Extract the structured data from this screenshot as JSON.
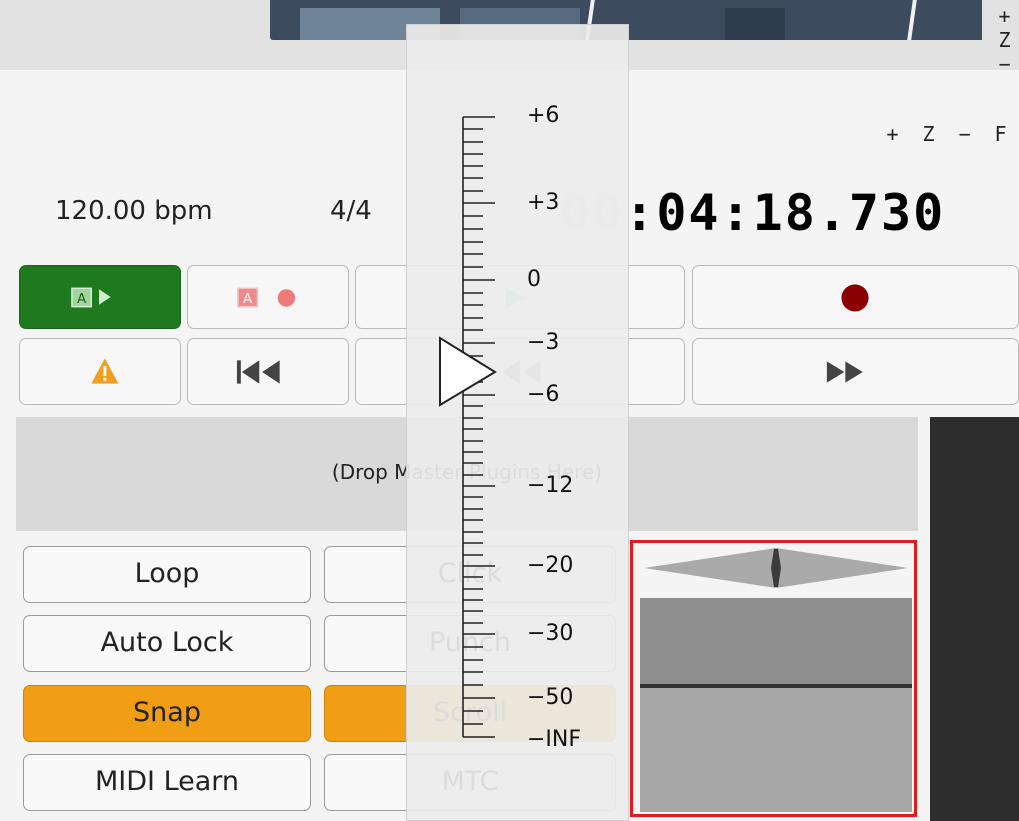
{
  "zoom_vertical": {
    "plus": "+",
    "z": "Z",
    "minus": "−"
  },
  "zoom_horizontal": {
    "plus": "+",
    "z": "Z",
    "minus": "−",
    "f": "F"
  },
  "tempo": "120.00 bpm",
  "meter": "4/4",
  "clock": {
    "dim": "00",
    "main": ":04:18.730"
  },
  "plugin_drop_label": "(Drop Master Plugins Here)",
  "toggles": {
    "left": [
      "Loop",
      "Auto Lock",
      "Snap",
      "MIDI Learn"
    ],
    "middle": [
      "Click",
      "Punch",
      "Scroll",
      "MTC"
    ]
  },
  "fader_scale": [
    "+6",
    "+3",
    "0",
    "−3",
    "−6",
    "−12",
    "−20",
    "−30",
    "−50",
    "−INF"
  ],
  "colors": {
    "accent_green": "#1f7a1f",
    "toggle_active": "#f19d16",
    "record_red": "#8b0000",
    "warning_orange": "#f0a020",
    "monitor_border": "#e3191d"
  },
  "icons": {
    "auto_play": "auto-play-icon",
    "auto_record": "auto-record-icon",
    "play": "play-icon",
    "record": "record-icon",
    "warning": "warning-icon",
    "to_start": "rewind-to-start-icon",
    "rewind": "rewind-icon",
    "fast_forward": "fast-forward-icon"
  }
}
